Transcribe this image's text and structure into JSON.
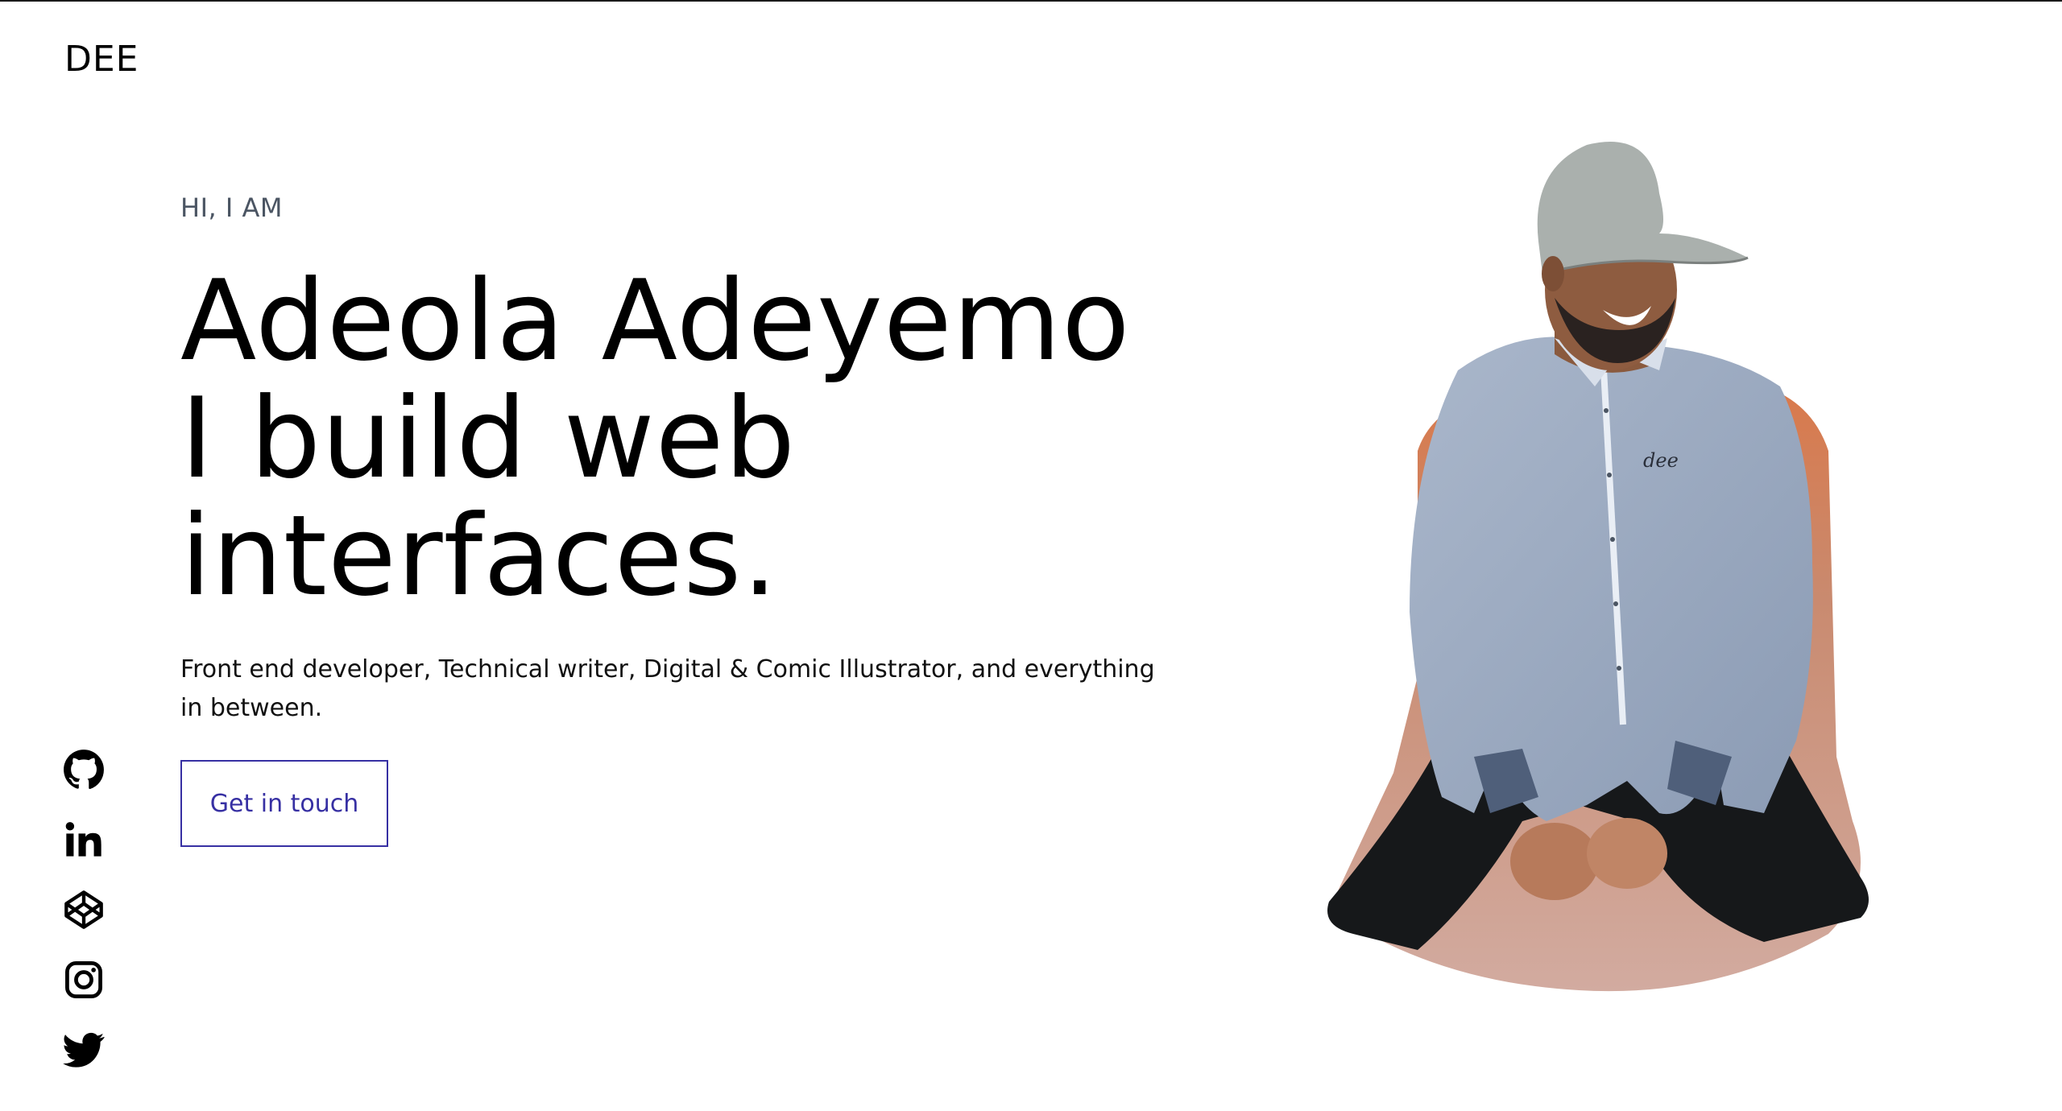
{
  "brand": {
    "logo_text": "DEE"
  },
  "hero": {
    "eyebrow": "HI, I AM",
    "headline_line1": "Adeola Adeyemo",
    "headline_line2": "I build web",
    "headline_line3": "interfaces.",
    "tagline": "Front end developer, Technical writer, Digital & Comic Illustrator, and everything in between.",
    "cta_label": "Get in touch"
  },
  "socials": [
    {
      "icon": "github-icon"
    },
    {
      "icon": "linkedin-icon"
    },
    {
      "icon": "codepen-icon"
    },
    {
      "icon": "instagram-icon"
    },
    {
      "icon": "twitter-icon"
    }
  ],
  "illustration": {
    "shirt_script": "dee"
  },
  "colors": {
    "accent": "#3730a3",
    "text": "#000000",
    "eyebrow": "#4b5563",
    "background": "#ffffff"
  }
}
